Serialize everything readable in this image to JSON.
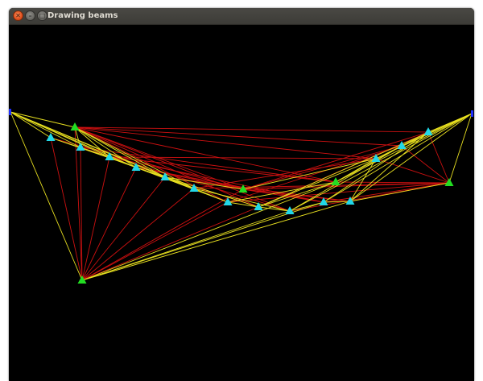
{
  "window": {
    "title": "Drawing beams",
    "close_icon": "close-icon",
    "minimize_icon": "minimize-icon",
    "maximize_icon": "maximize-icon"
  },
  "canvas": {
    "background": "#000000",
    "colors": {
      "tension_beam": "#cc1010",
      "compression_beam": "#e8e020",
      "fixed_node": "#22dd22",
      "free_node": "#22d8e8",
      "support_node": "#2030ff"
    }
  }
}
